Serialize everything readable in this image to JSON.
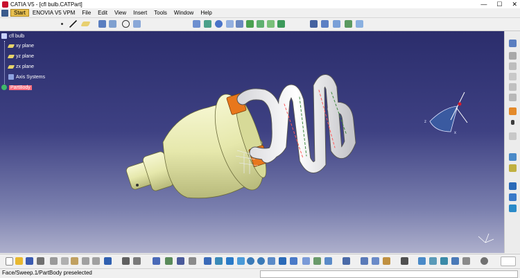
{
  "window": {
    "title": "CATIA V5 - [cfl bulb.CATPart]",
    "controls": [
      "—",
      "☐",
      "✕"
    ]
  },
  "menubar": {
    "items": [
      "Start",
      "ENOVIA V5 VPM",
      "File",
      "Edit",
      "View",
      "Insert",
      "Tools",
      "Window",
      "Help"
    ]
  },
  "tree": {
    "root": "cfl bulb",
    "items": [
      "xy plane",
      "yz plane",
      "zx plane",
      "Axis Systems",
      "PartBody"
    ]
  },
  "compass": {
    "x_label": "x",
    "y_label": "y",
    "z_label": "z"
  },
  "statusbar": {
    "text": "Face/Sweep.1/PartBody preselected",
    "command_value": ""
  },
  "colors": {
    "viewport_top": "#2b2d6c",
    "viewport_bottom": "#aeb0cc",
    "part_highlight": "#ff6f7f",
    "bulb_base": "#e9ebb5",
    "connector": "#e8771c",
    "tube": "#f2f2f4"
  }
}
